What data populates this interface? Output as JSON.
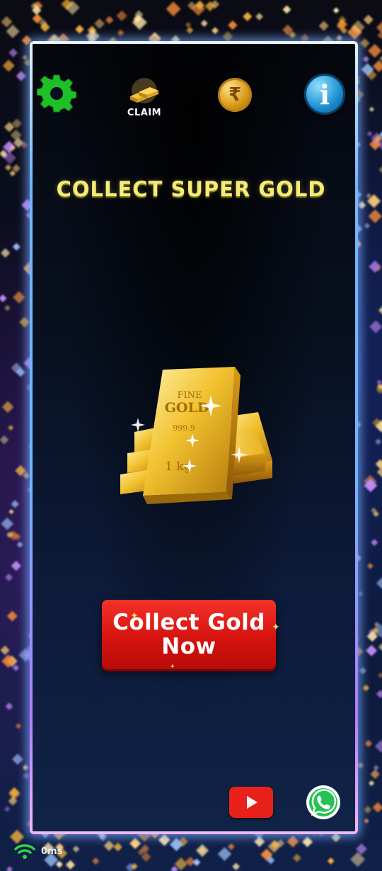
{
  "header": {
    "settings_icon": "gear-icon",
    "claim_label": "CLAIM",
    "coin_symbol": "₹",
    "info_symbol": "i"
  },
  "main": {
    "title": "COLLECT SUPER GOLD",
    "gold_bar_top_text": "FINE",
    "gold_bar_brand": "GOLD",
    "gold_bar_purity": "999.9",
    "gold_bar_weight": "1 kg",
    "cta_line1": "Collect Gold",
    "cta_line2": "Now"
  },
  "footer": {
    "youtube_icon": "youtube-play-icon",
    "whatsapp_icon": "whatsapp-icon",
    "latency": "0ms"
  },
  "colors": {
    "title": "#f4ec7a",
    "cta": "#e01a14",
    "gear": "#21b829",
    "frame_blue": "#6fb6ff",
    "frame_purple": "#b07cff"
  }
}
